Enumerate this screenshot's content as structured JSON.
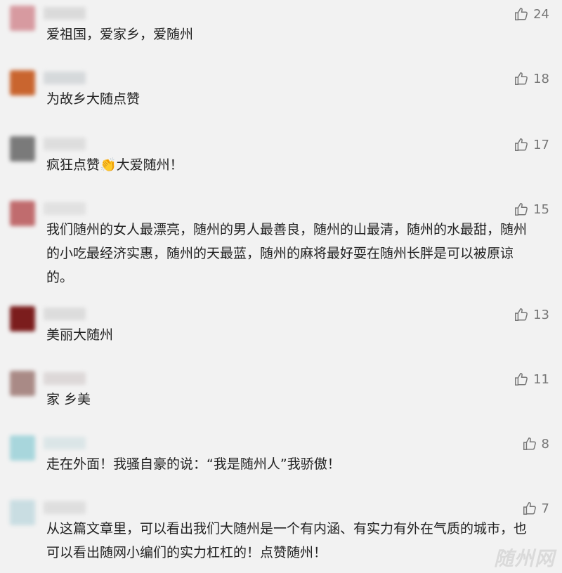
{
  "comments": [
    {
      "text": "爱祖国，爱家乡，爱随州",
      "likes": "24",
      "avatar_color": "#d79aa0",
      "name_color": "#d5d5d5"
    },
    {
      "text": "为故乡大随点赞",
      "likes": "18",
      "avatar_color": "#c9652f",
      "name_color": "#cfd3d6"
    },
    {
      "text": "疯狂点赞👏大爱随州！",
      "likes": "17",
      "avatar_color": "#7a7a7a",
      "name_color": "#d9d9d9"
    },
    {
      "text": "我们随州的女人最漂亮，随州的男人最善良，随州的山最清，随州的水最甜，随州的小吃最经济实惠，随州的天最蓝，随州的麻将最好耍在随州长胖是可以被原谅的。",
      "likes": "15",
      "avatar_color": "#c06c6e",
      "name_color": "#dddddd"
    },
    {
      "text": "美丽大随州",
      "likes": "13",
      "avatar_color": "#7b1d1d",
      "name_color": "#d7d7d7"
    },
    {
      "text": "家 乡美",
      "likes": "11",
      "avatar_color": "#a98a86",
      "name_color": "#d8d2d2"
    },
    {
      "text": "走在外面！我骚自豪的说：“我是随州人”我骄傲！",
      "likes": "8",
      "avatar_color": "#a8d6dc",
      "name_color": "#d6e3e5"
    },
    {
      "text": "从这篇文章里，可以看出我们大随州是一个有内涵、有实力有外在气质的城市，也可以看出随网小编们的实力杠杠的！点赞随州！",
      "likes": "7",
      "avatar_color": "#c9dde2",
      "name_color": "#dadada"
    }
  ],
  "watermark": "随州网",
  "icons": {
    "like": "thumbs-up-icon"
  }
}
